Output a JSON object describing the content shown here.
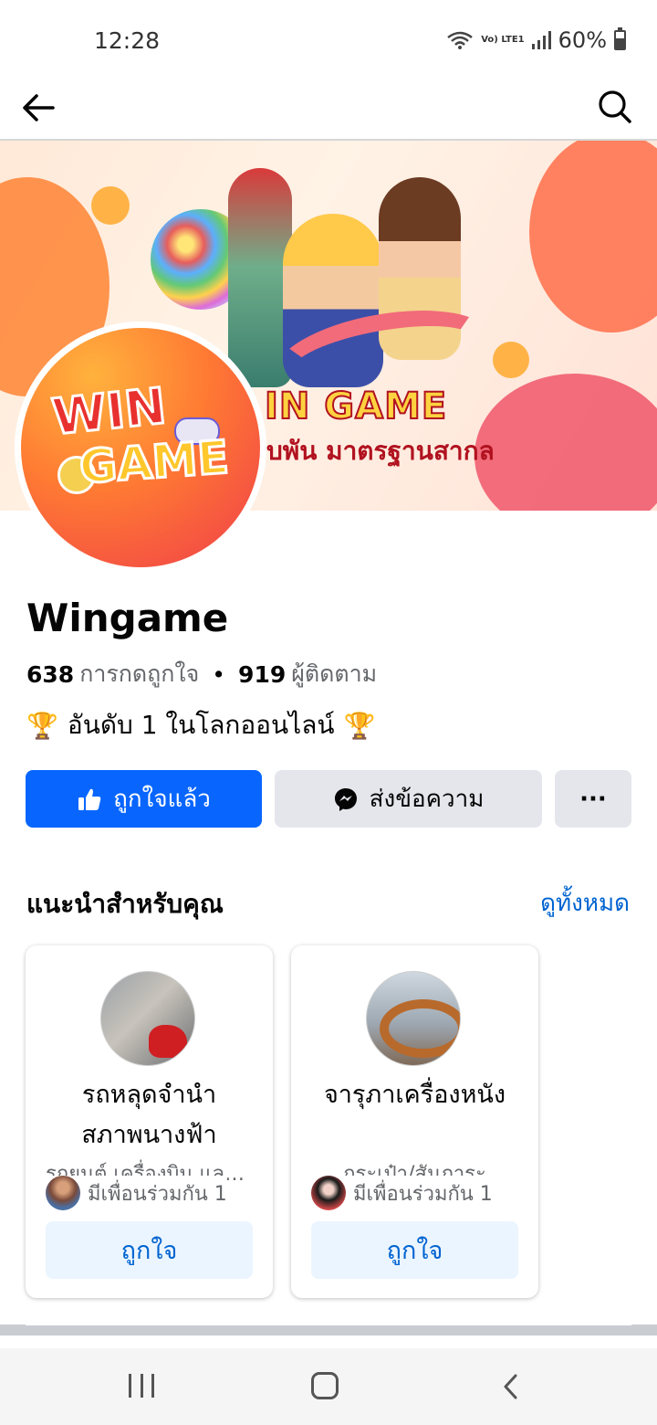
{
  "status_bar": {
    "time": "12:28",
    "network": "Vo) LTE1",
    "battery": "60%"
  },
  "cover": {
    "headline": "IN GAME",
    "subline": "บพัน มาตรฐานสากล"
  },
  "logo": {
    "line1": "WIN",
    "line2": "GAME"
  },
  "page": {
    "name": "Wingame",
    "likes_count": "638",
    "likes_label": "การกดถูกใจ",
    "followers_count": "919",
    "followers_label": "ผู้ติดตาม",
    "bio": "อันดับ 1  ในโลกออนไลน์",
    "trophy_glyph": "🏆"
  },
  "actions": {
    "liked_label": "ถูกใจแล้ว",
    "message_label": "ส่งข้อความ",
    "more_label": "···"
  },
  "suggestions": {
    "title": "แนะนำสำหรับคุณ",
    "see_all": "ดูทั้งหมด",
    "cards": [
      {
        "name": "รถหลุดจำนำสภาพนางฟ้า",
        "category": "รถยนต์ เครื่องบิน และ...",
        "mutual": "มีเพื่อนร่วมกัน 1",
        "button": "ถูกใจ"
      },
      {
        "name": "จารุภาเครื่องหนัง",
        "category": "กระเป๋า/สัมภาระ",
        "mutual": "มีเพื่อนร่วมกัน 1",
        "button": "ถูกใจ"
      }
    ]
  },
  "colors": {
    "accent": "#0866ff",
    "link": "#0064d1",
    "secondary_button": "#e4e6eb",
    "muted_text": "#65676b"
  }
}
